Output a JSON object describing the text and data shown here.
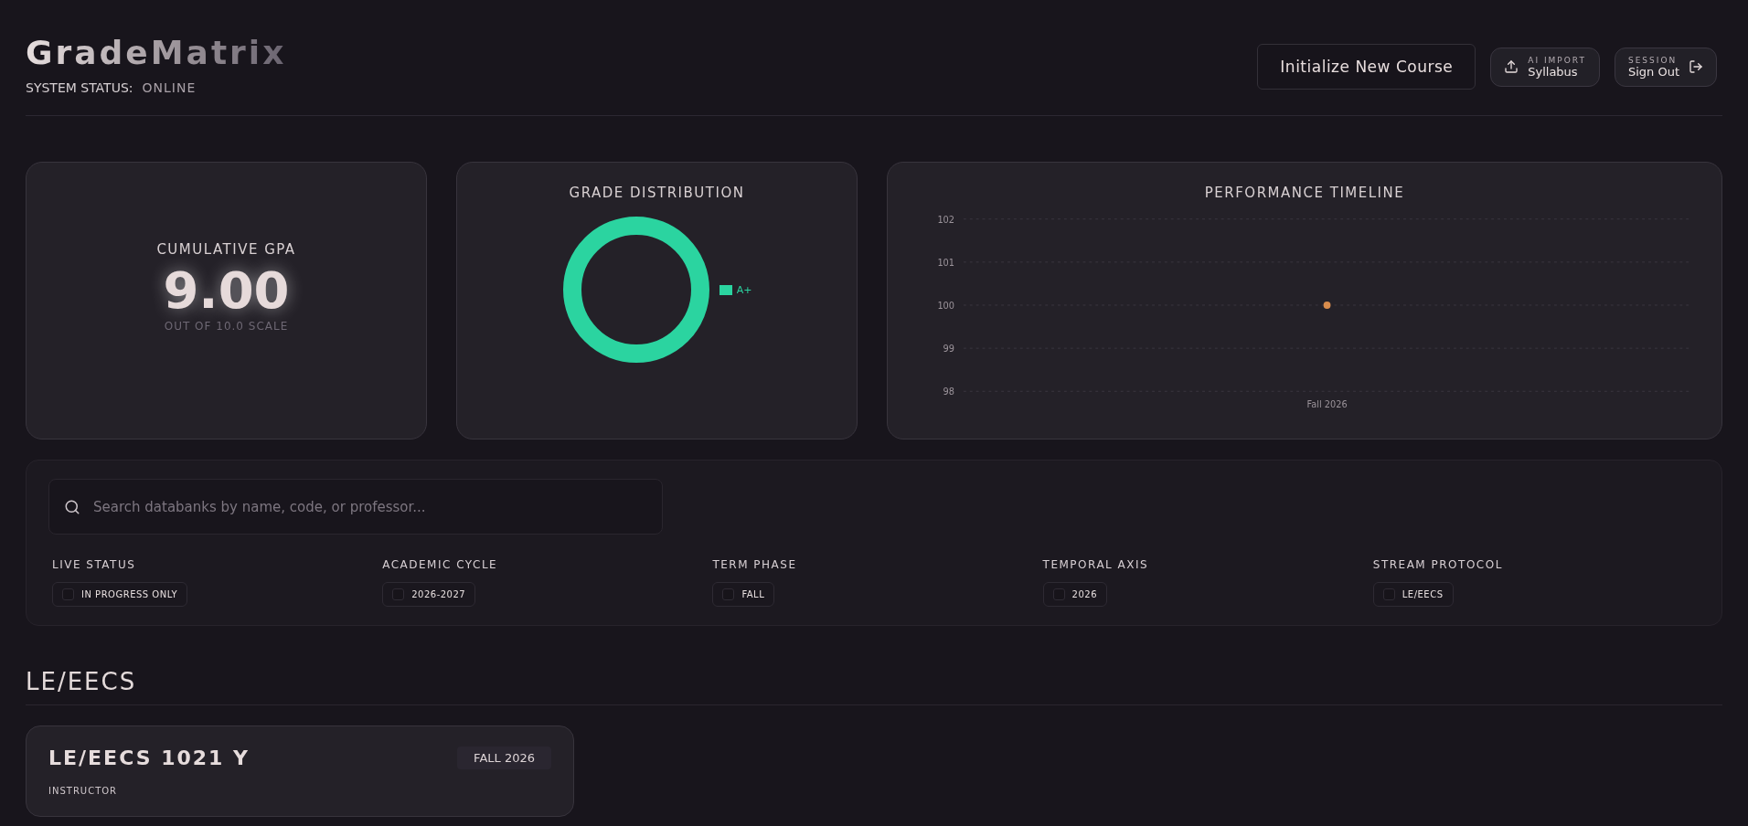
{
  "header": {
    "logo": "GradeMatrix",
    "status_label": "SYSTEM STATUS:",
    "status_value": "ONLINE",
    "primary_button": "Initialize New Course",
    "actions": [
      {
        "kind": "import",
        "caption": "AI IMPORT",
        "label": "Syllabus"
      },
      {
        "kind": "signout",
        "caption": "SESSION",
        "label": "Sign Out"
      }
    ]
  },
  "gpa_card": {
    "title": "CUMULATIVE GPA",
    "value": "9.00",
    "subtitle": "OUT OF 10.0 SCALE"
  },
  "distribution_card": {
    "title": "GRADE DISTRIBUTION",
    "slices": [
      {
        "label": "A+",
        "color": "#2bd4a0"
      }
    ]
  },
  "timeline_card": {
    "title": "PERFORMANCE TIMELINE",
    "chart_data": {
      "type": "line",
      "categories": [
        "Fall 2026"
      ],
      "series": [
        {
          "color": "#d88c4c",
          "values": [
            100
          ],
          "marker": true
        }
      ],
      "ylim": [
        98,
        102
      ],
      "yticks": [
        98,
        99,
        100,
        101,
        102
      ],
      "grid": true
    }
  },
  "filters": {
    "search_placeholder": "Search databanks by name, code, or professor...",
    "groups": [
      {
        "title": "LIVE STATUS",
        "option": "IN PROGRESS ONLY",
        "checked": false
      },
      {
        "title": "ACADEMIC CYCLE",
        "option": "2026-2027",
        "checked": false
      },
      {
        "title": "TERM PHASE",
        "option": "FALL",
        "checked": false
      },
      {
        "title": "TEMPORAL AXIS",
        "option": "2026",
        "checked": false
      },
      {
        "title": "STREAM PROTOCOL",
        "option": "LE/EECS",
        "checked": false
      }
    ]
  },
  "sections": [
    {
      "title": "LE/EECS",
      "courses": [
        {
          "code": "LE/EECS 1021 Y",
          "term": "FALL 2026",
          "instructor_label": "INSTRUCTOR"
        }
      ]
    }
  ]
}
